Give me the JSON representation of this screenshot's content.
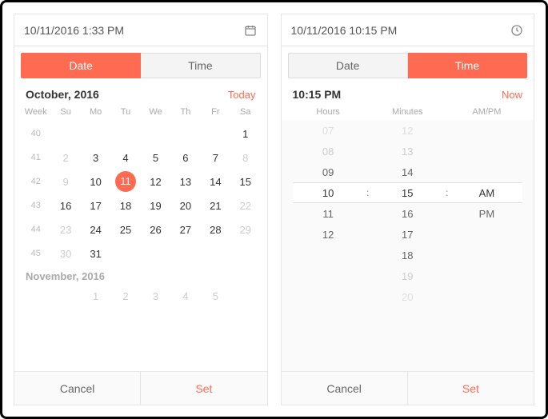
{
  "accent": "#ff6b52",
  "left": {
    "input_value": "10/11/2016 1:33 PM",
    "tabs": {
      "date": "Date",
      "time": "Time",
      "active": "date"
    },
    "month_label": "October, 2016",
    "today_label": "Today",
    "week_col": "Week",
    "day_headers": [
      "Su",
      "Mo",
      "Tu",
      "We",
      "Th",
      "Fr",
      "Sa"
    ],
    "rows": [
      {
        "wk": 40,
        "days": [
          "",
          "",
          "",
          "",
          "",
          "",
          1
        ],
        "out": [
          false,
          false,
          false,
          false,
          false,
          false,
          false
        ]
      },
      {
        "wk": 41,
        "days": [
          2,
          3,
          4,
          5,
          6,
          7,
          8
        ],
        "out": [
          true,
          false,
          false,
          false,
          false,
          false,
          true
        ]
      },
      {
        "wk": 42,
        "days": [
          9,
          10,
          11,
          12,
          13,
          14,
          15
        ],
        "out": [
          true,
          false,
          false,
          false,
          false,
          false,
          false
        ]
      },
      {
        "wk": 43,
        "days": [
          16,
          17,
          18,
          19,
          20,
          21,
          22
        ],
        "out": [
          false,
          false,
          false,
          false,
          false,
          false,
          true
        ]
      },
      {
        "wk": 44,
        "days": [
          23,
          24,
          25,
          26,
          27,
          28,
          29
        ],
        "out": [
          true,
          false,
          false,
          false,
          false,
          false,
          true
        ]
      },
      {
        "wk": 45,
        "days": [
          30,
          31,
          "",
          "",
          "",
          "",
          ""
        ],
        "out": [
          true,
          false,
          false,
          false,
          false,
          false,
          false
        ]
      }
    ],
    "selected_day": 11,
    "next_month_label": "November, 2016",
    "next_month_row": {
      "wk": "",
      "days": [
        "",
        1,
        2,
        3,
        4,
        5,
        ""
      ],
      "out": [
        false,
        true,
        true,
        true,
        true,
        true,
        false
      ]
    },
    "cancel": "Cancel",
    "set": "Set"
  },
  "right": {
    "input_value": "10/11/2016 10:15 PM",
    "tabs": {
      "date": "Date",
      "time": "Time",
      "active": "time"
    },
    "time_label": "10:15 PM",
    "now_label": "Now",
    "col_headers": {
      "hours": "Hours",
      "minutes": "Minutes",
      "ampm": "AM/PM"
    },
    "hours": [
      "07",
      "08",
      "09",
      "10",
      "11",
      "12",
      "",
      "",
      ""
    ],
    "minutes": [
      "12",
      "13",
      "14",
      "15",
      "16",
      "17",
      "18",
      "19",
      "20"
    ],
    "ampm": [
      "",
      "",
      "",
      "AM",
      "PM",
      "",
      "",
      "",
      ""
    ],
    "selected_index": 3,
    "cancel": "Cancel",
    "set": "Set"
  }
}
